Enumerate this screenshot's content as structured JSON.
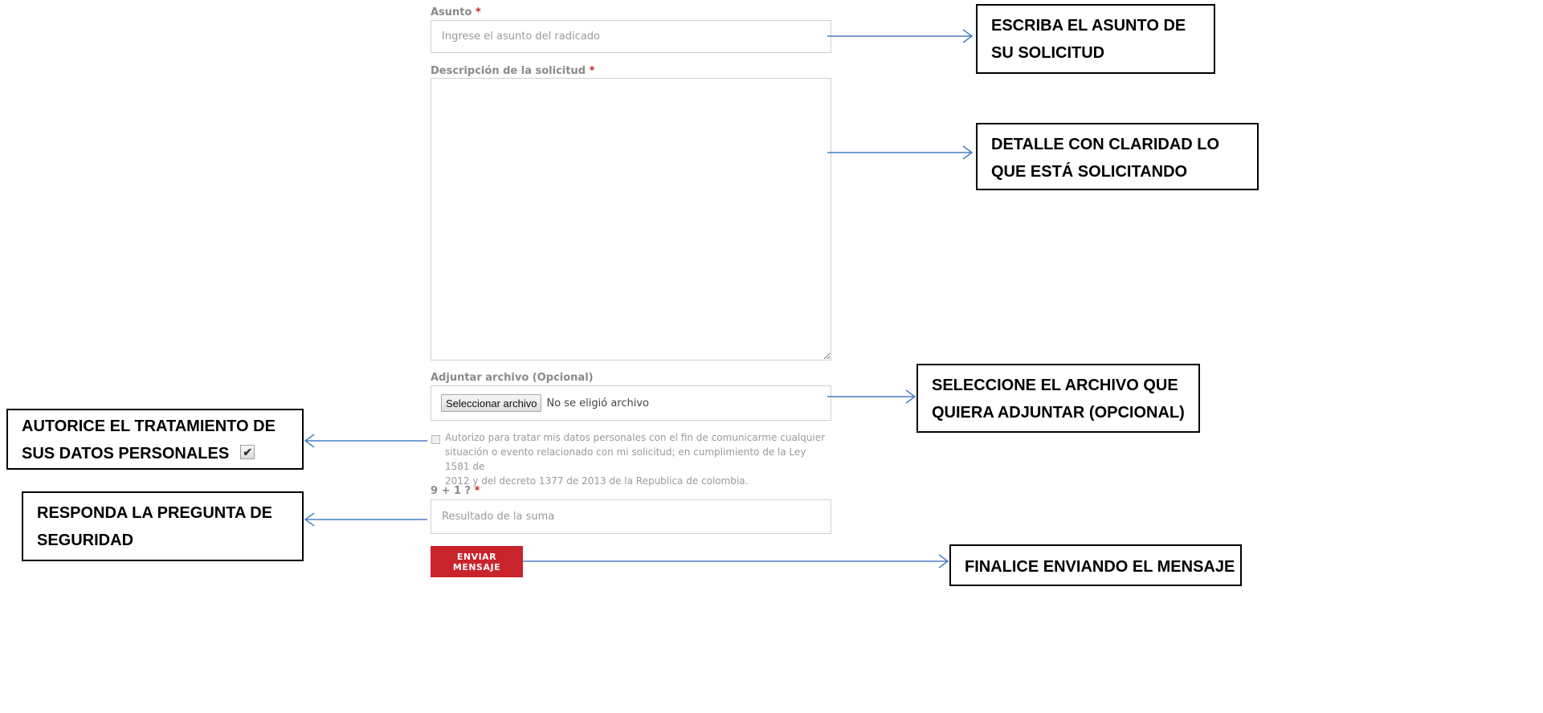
{
  "form": {
    "subject": {
      "label": "Asunto",
      "required_mark": "*",
      "placeholder": "Ingrese el asunto del radicado"
    },
    "description": {
      "label": "Descripción de la solicitud",
      "required_mark": "*"
    },
    "attachment": {
      "label": "Adjuntar archivo (Opcional)",
      "button": "Seleccionar archivo",
      "status": "No se eligió archivo"
    },
    "consent": {
      "checked": false,
      "lines": [
        "Autorizo para tratar mis datos personales con el fin de comunicarme cualquier",
        "situación o evento relacionado con mi solicitud; en cumplimiento de la Ley 1581 de",
        "2012 y del decreto 1377 de 2013 de la Republica de colombia."
      ]
    },
    "captcha": {
      "label": "9 + 1 ?",
      "required_mark": "*",
      "placeholder": "Resultado de la suma"
    },
    "submit_label": "ENVIAR MENSAJE"
  },
  "callouts": {
    "subject": [
      "ESCRIBA EL ASUNTO DE",
      "SU SOLICITUD"
    ],
    "description": [
      "DETALLE  CON CLARIDAD LO",
      "QUE ESTÁ SOLICITANDO"
    ],
    "attachment": [
      "SELECCIONE EL ARCHIVO QUE",
      "QUIERA ADJUNTAR (OPCIONAL)"
    ],
    "consent": [
      "AUTORICE EL TRATAMIENTO DE",
      "SUS DATOS PERSONALES"
    ],
    "captcha": [
      "RESPONDA LA PREGUNTA DE",
      "SEGURIDAD"
    ],
    "submit": [
      "FINALICE ENVIANDO EL MENSAJE"
    ]
  },
  "colors": {
    "accent": "#c9232b",
    "arrow": "#4a7ec2"
  },
  "icons": {
    "consent_example": "checkmark-icon"
  }
}
